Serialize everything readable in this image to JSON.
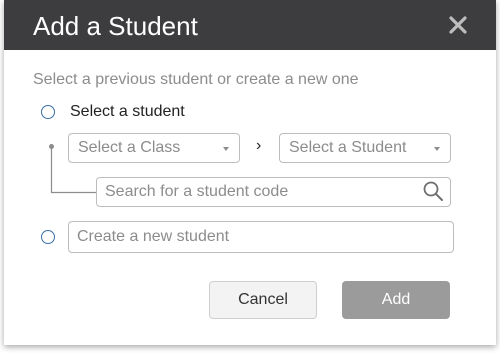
{
  "dialog": {
    "title": "Add a Student",
    "subtitle": "Select a previous student or create a new one",
    "option_select_label": "Select a student",
    "class_select": "Select a Class",
    "separator": "›",
    "student_select": "Select a Student",
    "search_placeholder": "Search for a student code",
    "create_placeholder": "Create a new student",
    "cancel_label": "Cancel",
    "add_label": "Add"
  },
  "icons": {
    "close": "close-icon",
    "search": "search-icon",
    "caret": "chevron-down-icon"
  },
  "colors": {
    "header": "#3d3d3f",
    "radio": "#3a6fa8",
    "add_button": "#9b9b9b"
  }
}
